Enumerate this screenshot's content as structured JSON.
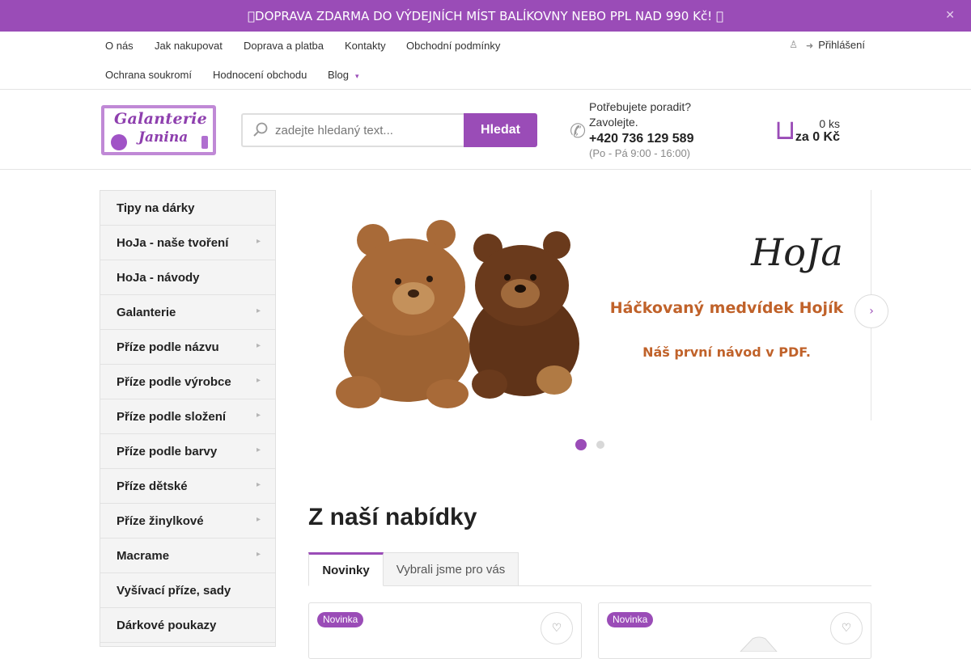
{
  "announcement": {
    "text": "DOPRAVA ZDARMA DO VÝDEJNÍCH MÍST BALÍKOVNY NEBO PPL NAD 990 Kč! ",
    "close_icon": "close-icon"
  },
  "nav": {
    "row1": [
      "O nás",
      "Jak nakupovat",
      "Doprava a platba",
      "Kontakty",
      "Obchodní podmínky"
    ],
    "row2": [
      "Ochrana soukromí",
      "Hodnocení obchodu",
      "Blog"
    ],
    "login": "Přihlášení",
    "icons": [
      "user-icon",
      "login-icon",
      "chevron-down-icon"
    ]
  },
  "logo": {
    "line1": "Galanterie",
    "line2": "Janina"
  },
  "search": {
    "placeholder": "zadejte hledaný text...",
    "button": "Hledat",
    "icon": "search-icon"
  },
  "contact": {
    "question": "Potřebujete poradit? Zavolejte.",
    "phone": "+420 736 129 589",
    "hours": "(Po - Pá 9:00 - 16:00)",
    "icon": "phone-icon"
  },
  "cart": {
    "count": "0 ks",
    "total": "za 0 Kč",
    "icon": "cart-icon"
  },
  "categories": [
    {
      "label": "Tipy na dárky",
      "has_sub": false
    },
    {
      "label": "HoJa - naše tvoření",
      "has_sub": true
    },
    {
      "label": "HoJa - návody",
      "has_sub": false
    },
    {
      "label": "Galanterie",
      "has_sub": true
    },
    {
      "label": "Příze podle názvu",
      "has_sub": true
    },
    {
      "label": "Příze podle výrobce",
      "has_sub": true
    },
    {
      "label": "Příze podle složení",
      "has_sub": true
    },
    {
      "label": "Příze podle barvy",
      "has_sub": true
    },
    {
      "label": "Příze dětské",
      "has_sub": true
    },
    {
      "label": "Příze žinylkové",
      "has_sub": true
    },
    {
      "label": "Macrame",
      "has_sub": true
    },
    {
      "label": "Vyšívací příze, sady",
      "has_sub": false
    },
    {
      "label": "Dárkové poukazy",
      "has_sub": false
    }
  ],
  "banner": {
    "brand": "HoJa",
    "headline": "Háčkovaný medvídek Hojík",
    "subline": "Náš první návod v PDF.",
    "slide_count": 2,
    "active_slide": 1
  },
  "offer": {
    "title": "Z naší nabídky",
    "tabs": [
      "Novinky",
      "Vybrali jsme pro vás"
    ],
    "active_tab": "Novinky"
  },
  "products": [
    {
      "badge": "Novinka"
    },
    {
      "badge": "Novinka"
    }
  ],
  "colors": {
    "accent": "#9a4cb7",
    "bear_light": "#a86a38",
    "bear_dark": "#6a3a1c",
    "banner_text": "#c0622a"
  }
}
